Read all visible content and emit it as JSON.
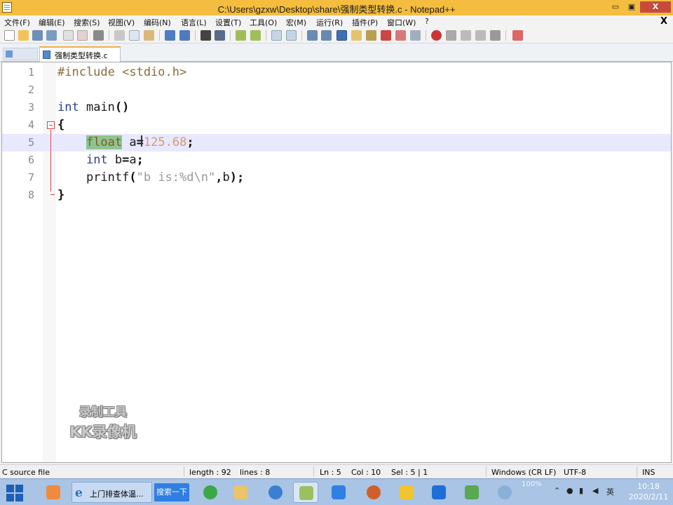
{
  "window": {
    "title": "C:\\Users\\gzxw\\Desktop\\share\\强制类型转换.c - Notepad++",
    "min_glyph": "▭",
    "max_glyph": "▣",
    "close_glyph": "X"
  },
  "menu": {
    "items": [
      "文件(F)",
      "编辑(E)",
      "搜索(S)",
      "视图(V)",
      "编码(N)",
      "语言(L)",
      "设置(T)",
      "工具(O)",
      "宏(M)",
      "运行(R)",
      "插件(P)",
      "窗口(W)",
      "?"
    ],
    "close_doc": "X"
  },
  "tabs": {
    "active_label": "强制类型转换.c"
  },
  "editor": {
    "line_numbers": [
      "1",
      "2",
      "3",
      "4",
      "5",
      "6",
      "7",
      "8"
    ],
    "line1": {
      "pre": "#include <stdio.h>"
    },
    "line3": {
      "kw": "int",
      "rest": " main",
      "paren": "()"
    },
    "line4": {
      "brace": "{"
    },
    "line5": {
      "indent": "    ",
      "type_sel": "float",
      "sp": " ",
      "var": "a",
      "eq": "=",
      "num": "125.68",
      "semi": ";"
    },
    "line6": {
      "indent": "    ",
      "kw": "int",
      "rest": " b",
      "eq": "=",
      "var": "a",
      "semi": ";"
    },
    "line7": {
      "indent": "    ",
      "fn": "printf",
      "op1": "(",
      "str": "\"b is:%d\\n\"",
      "comma": ",",
      "var": "b",
      "op2": ");"
    },
    "line8": {
      "brace": "}"
    },
    "current_line": 5
  },
  "watermark": {
    "line1": "录制工具",
    "line2": "KK录像机"
  },
  "status": {
    "file_type": "C source file",
    "length": "length : 92",
    "lines": "lines : 8",
    "ln": "Ln : 5",
    "col": "Col : 10",
    "sel": "Sel : 5 | 1",
    "eol": "Windows (CR LF)",
    "encoding": "UTF-8",
    "mode": "INS"
  },
  "taskbar": {
    "ie_label": "上门排查体温...",
    "search_label": "搜索一下",
    "ime": "英",
    "zoom": "100%",
    "time": "10:18",
    "date": "2020/2/11"
  },
  "colors": {
    "titlebar": "#f5bd3f",
    "current_line": "#e8e8ff",
    "selection": "#8fc48f",
    "taskbar": "#a9c4e5"
  }
}
